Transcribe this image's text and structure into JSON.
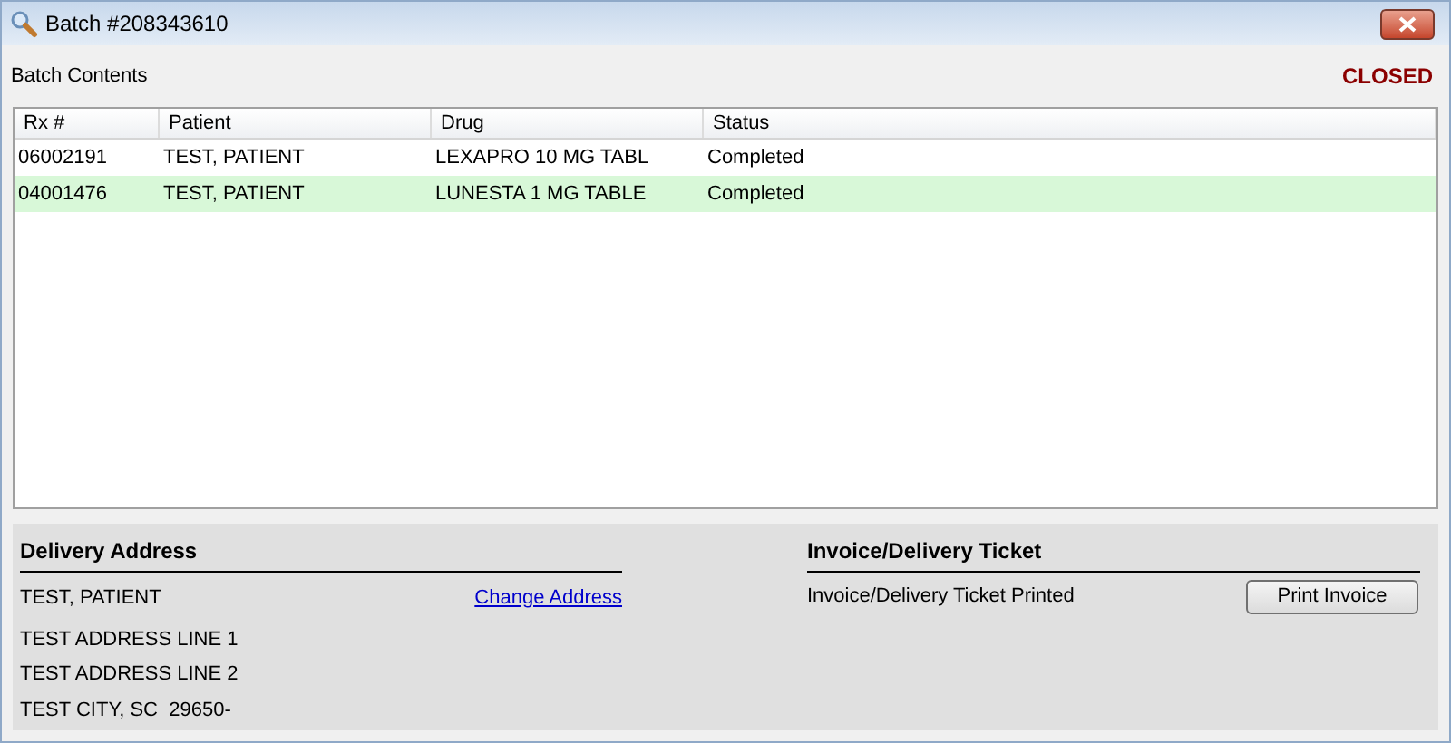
{
  "window": {
    "title": "Batch #208343610"
  },
  "section_title": "Batch Contents",
  "batch_status": "CLOSED",
  "table": {
    "columns": [
      "Rx #",
      "Patient",
      "Drug",
      "Status"
    ],
    "rows": [
      {
        "cells": [
          "06002191",
          "TEST, PATIENT",
          "LEXAPRO 10 MG TABL",
          "Completed"
        ],
        "selected": false
      },
      {
        "cells": [
          "04001476",
          "TEST, PATIENT",
          "LUNESTA 1 MG TABLE",
          "Completed"
        ],
        "selected": true
      }
    ]
  },
  "delivery_address": {
    "heading": "Delivery Address",
    "name": "TEST, PATIENT",
    "link": "Change Address",
    "lines": [
      "TEST ADDRESS LINE 1",
      "TEST ADDRESS LINE 2",
      "TEST CITY, SC  29650-"
    ]
  },
  "invoice": {
    "heading": "Invoice/Delivery Ticket",
    "status": "Invoice/Delivery Ticket Printed",
    "button": "Print Invoice"
  }
}
